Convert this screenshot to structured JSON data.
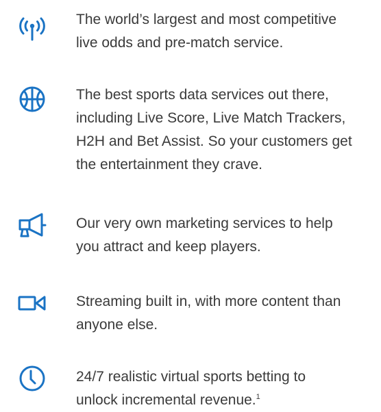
{
  "accent_color": "#1a73c4",
  "features": [
    {
      "icon": "broadcast-antenna-icon",
      "lines": [
        "The world’s largest and most competitive",
        "live odds and pre-match service."
      ]
    },
    {
      "icon": "basketball-icon",
      "lines": [
        "The best sports data services out there,",
        "including Live Score, Live Match Trackers,",
        "H2H and Bet Assist. So your customers get",
        "the entertainment they crave."
      ]
    },
    {
      "icon": "megaphone-icon",
      "lines": [
        "Our very own marketing services to help",
        "you attract and keep players."
      ]
    },
    {
      "icon": "video-camera-icon",
      "lines": [
        "Streaming built in, with more content than",
        "anyone else."
      ]
    },
    {
      "icon": "clock-icon",
      "lines": [
        "24/7 realistic virtual sports betting to",
        "unlock incremental revenue."
      ],
      "footnote": "1"
    }
  ]
}
